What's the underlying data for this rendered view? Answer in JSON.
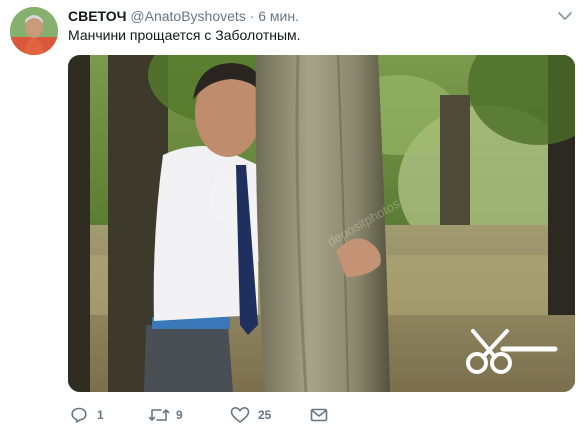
{
  "tweet": {
    "name": "СВЕТОЧ",
    "handle": "@AnatoByshovets",
    "separator": "·",
    "time": "6 мин.",
    "text": "Манчини прощается с Заболотным.",
    "watermark": "depositphotos"
  },
  "actions": {
    "reply_count": "1",
    "retweet_count": "9",
    "like_count": "25"
  },
  "icons": {
    "menu": "chevron-down-icon",
    "reply": "reply-icon",
    "retweet": "retweet-icon",
    "like": "heart-icon",
    "dm": "envelope-icon",
    "media_badge": "scissors-icon"
  },
  "colors": {
    "text": "#14171a",
    "secondary": "#657786"
  }
}
